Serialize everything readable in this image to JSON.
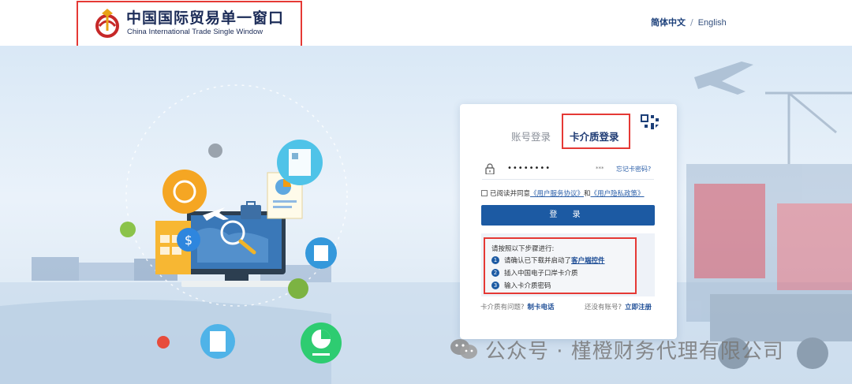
{
  "header": {
    "logo_cn": "中国国际贸易单一窗口",
    "logo_en": "China International Trade Single Window",
    "lang_cn": "简体中文",
    "lang_sep": "/",
    "lang_en": "English"
  },
  "login": {
    "tab_account": "账号登录",
    "tab_card": "卡介质登录",
    "password_value": "••••••••",
    "eye_toggle": "***",
    "forgot_password": "忘记卡密码?",
    "agree_prefix": "已阅读并同意",
    "agree_service": "《用户服务协议》",
    "agree_and": "和",
    "agree_privacy": "《用户隐私政策》",
    "login_button": "登 录",
    "steps_title": "请按照以下步骤进行:",
    "steps": [
      {
        "num": "1",
        "text": "请确认已下载并启动了",
        "link": "客户端控件"
      },
      {
        "num": "2",
        "text": "插入中国电子口岸卡介质",
        "link": ""
      },
      {
        "num": "3",
        "text": "输入卡介质密码",
        "link": ""
      }
    ],
    "help_text": "卡介质有问题?",
    "help_link": "制卡电话",
    "register_text": "还没有账号?",
    "register_link": "立即注册"
  },
  "watermark": {
    "text": "公众号 · 槿橙财务代理有限公司"
  },
  "colors": {
    "primary": "#1c5aa3",
    "highlight_box": "#e53935",
    "link": "#2a5ea8"
  }
}
